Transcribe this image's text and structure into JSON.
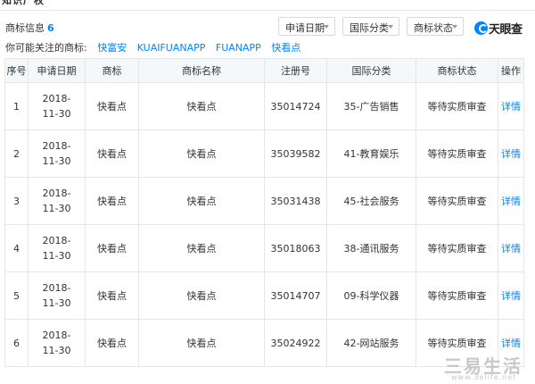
{
  "top_tab": "知识产权",
  "section": {
    "title": "商标信息",
    "count": "6"
  },
  "filters": [
    {
      "label": "申请日期"
    },
    {
      "label": "国际分类"
    },
    {
      "label": "商标状态"
    }
  ],
  "logo": {
    "text": "天眼查",
    "icon": "tianyancha-logo-icon"
  },
  "suggest": {
    "prefix": "你可能关注的商标:",
    "links": [
      "快富安",
      "KUAIFUANAPP",
      "FUANAPP",
      "快看点"
    ]
  },
  "table": {
    "headers": [
      "序号",
      "申请日期",
      "商标",
      "商标名称",
      "注册号",
      "国际分类",
      "商标状态",
      "操作"
    ],
    "rows": [
      {
        "no": "1",
        "date": "2018-11-30",
        "mark": "快看点",
        "name": "快看点",
        "reg": "35014724",
        "class": "35-广告销售",
        "status": "等待实质审查",
        "action": "详情"
      },
      {
        "no": "2",
        "date": "2018-11-30",
        "mark": "快看点",
        "name": "快看点",
        "reg": "35039582",
        "class": "41-教育娱乐",
        "status": "等待实质审查",
        "action": "详情"
      },
      {
        "no": "3",
        "date": "2018-11-30",
        "mark": "快看点",
        "name": "快看点",
        "reg": "35031438",
        "class": "45-社会服务",
        "status": "等待实质审查",
        "action": "详情"
      },
      {
        "no": "4",
        "date": "2018-11-30",
        "mark": "快看点",
        "name": "快看点",
        "reg": "35018063",
        "class": "38-通讯服务",
        "status": "等待实质审查",
        "action": "详情"
      },
      {
        "no": "5",
        "date": "2018-11-30",
        "mark": "快看点",
        "name": "快看点",
        "reg": "35014707",
        "class": "09-科学仪器",
        "status": "等待实质审查",
        "action": "详情"
      },
      {
        "no": "6",
        "date": "2018-11-30",
        "mark": "快看点",
        "name": "快看点",
        "reg": "35024922",
        "class": "42-网站服务",
        "status": "等待实质审查",
        "action": "详情"
      }
    ]
  },
  "watermark": {
    "text": "三易生活",
    "url": "www.3elife.net"
  },
  "colors": {
    "accent": "#0084ff",
    "border": "#e6e6e6",
    "header_bg": "#f5f8fa"
  }
}
